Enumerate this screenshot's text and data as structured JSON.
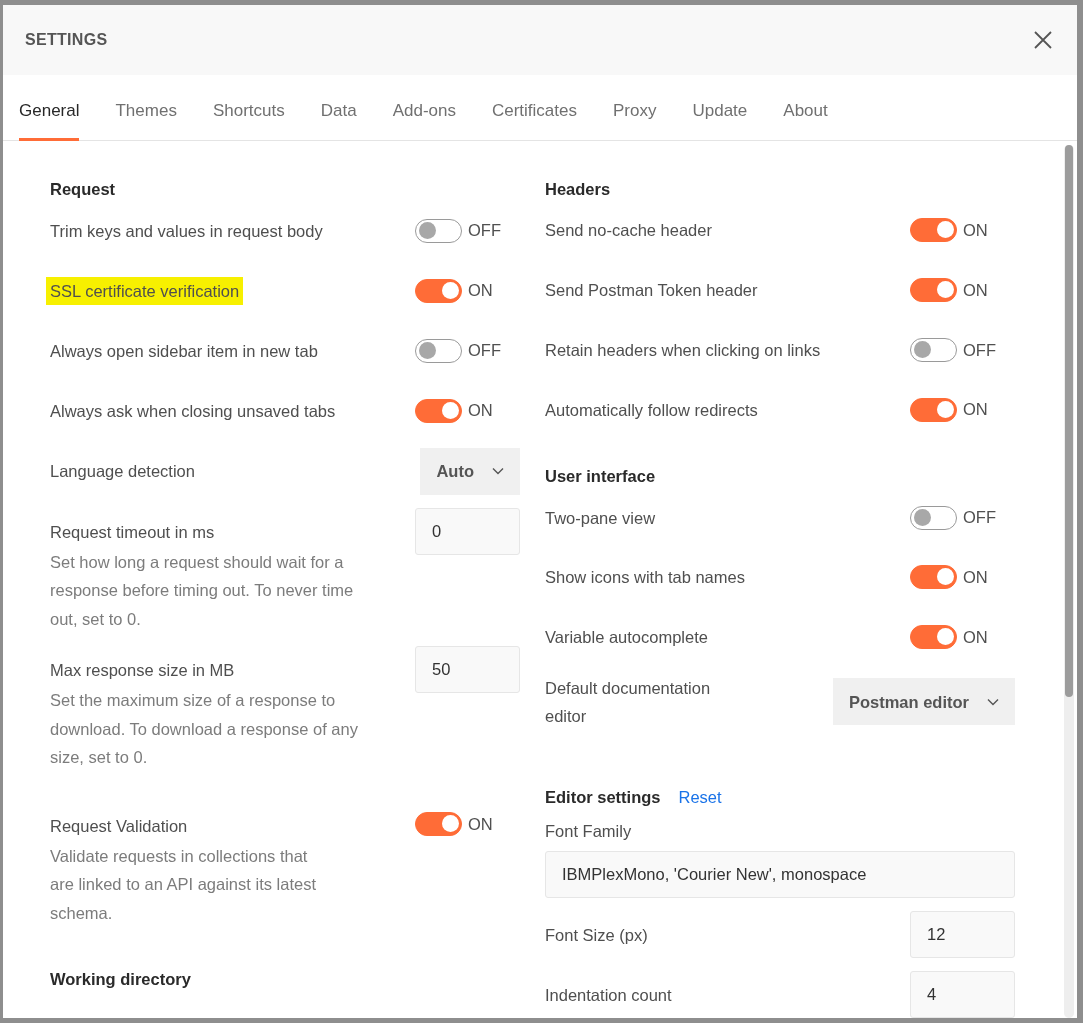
{
  "window": {
    "title": "SETTINGS"
  },
  "tabs": [
    {
      "label": "General",
      "selected": true
    },
    {
      "label": "Themes",
      "selected": false
    },
    {
      "label": "Shortcuts",
      "selected": false
    },
    {
      "label": "Data",
      "selected": false
    },
    {
      "label": "Add-ons",
      "selected": false
    },
    {
      "label": "Certificates",
      "selected": false
    },
    {
      "label": "Proxy",
      "selected": false
    },
    {
      "label": "Update",
      "selected": false
    },
    {
      "label": "About",
      "selected": false
    }
  ],
  "columns": [
    {
      "items": [
        {
          "kind": "heading",
          "label": "Request"
        },
        {
          "kind": "toggle",
          "label": "Trim keys and values in request body",
          "on": false,
          "state_label": "OFF",
          "highlighted": false
        },
        {
          "kind": "toggle",
          "label": "SSL certificate verification",
          "on": true,
          "state_label": "ON",
          "highlighted": true
        },
        {
          "kind": "toggle",
          "label": "Always open sidebar item in new tab",
          "on": false,
          "state_label": "OFF",
          "highlighted": false
        },
        {
          "kind": "toggle",
          "label": "Always ask when closing unsaved tabs",
          "on": true,
          "state_label": "ON",
          "highlighted": false
        },
        {
          "kind": "select",
          "label": "Language detection",
          "value": "Auto"
        },
        {
          "kind": "number",
          "label": "Request timeout in ms",
          "value": "0",
          "description": "Set how long a request should wait for a response before timing out. To never time out, set to 0."
        },
        {
          "kind": "number",
          "label": "Max response size in MB",
          "value": "50",
          "description": "Set the maximum size of a response to download. To download a response of any size, set to 0."
        },
        {
          "kind": "toggle",
          "label": "Request Validation",
          "on": true,
          "state_label": "ON",
          "highlighted": false,
          "description": "Validate requests in collections that are linked to an API against its latest schema."
        },
        {
          "kind": "heading",
          "label": "Working directory"
        }
      ]
    },
    {
      "items": [
        {
          "kind": "heading",
          "label": "Headers"
        },
        {
          "kind": "toggle",
          "label": "Send no-cache header",
          "on": true,
          "state_label": "ON",
          "highlighted": false
        },
        {
          "kind": "toggle",
          "label": "Send Postman Token header",
          "on": true,
          "state_label": "ON",
          "highlighted": false
        },
        {
          "kind": "toggle",
          "label": "Retain headers when clicking on links",
          "on": false,
          "state_label": "OFF",
          "highlighted": false
        },
        {
          "kind": "toggle",
          "label": "Automatically follow redirects",
          "on": true,
          "state_label": "ON",
          "highlighted": false
        },
        {
          "kind": "heading",
          "label": "User interface"
        },
        {
          "kind": "toggle",
          "label": "Two-pane view",
          "on": false,
          "state_label": "OFF",
          "highlighted": false
        },
        {
          "kind": "toggle",
          "label": "Show icons with tab names",
          "on": true,
          "state_label": "ON",
          "highlighted": false
        },
        {
          "kind": "toggle",
          "label": "Variable autocomplete",
          "on": true,
          "state_label": "ON",
          "highlighted": false
        },
        {
          "kind": "select",
          "label": "Default documentation editor",
          "value": "Postman editor"
        },
        {
          "kind": "heading",
          "label": "Editor settings",
          "link": "Reset"
        },
        {
          "kind": "wide_field",
          "label": "Font Family",
          "value": "IBMPlexMono, 'Courier New', monospace"
        },
        {
          "kind": "number",
          "label": "Font Size (px)",
          "value": "12"
        },
        {
          "kind": "number",
          "label": "Indentation count",
          "value": "4"
        }
      ]
    }
  ]
}
